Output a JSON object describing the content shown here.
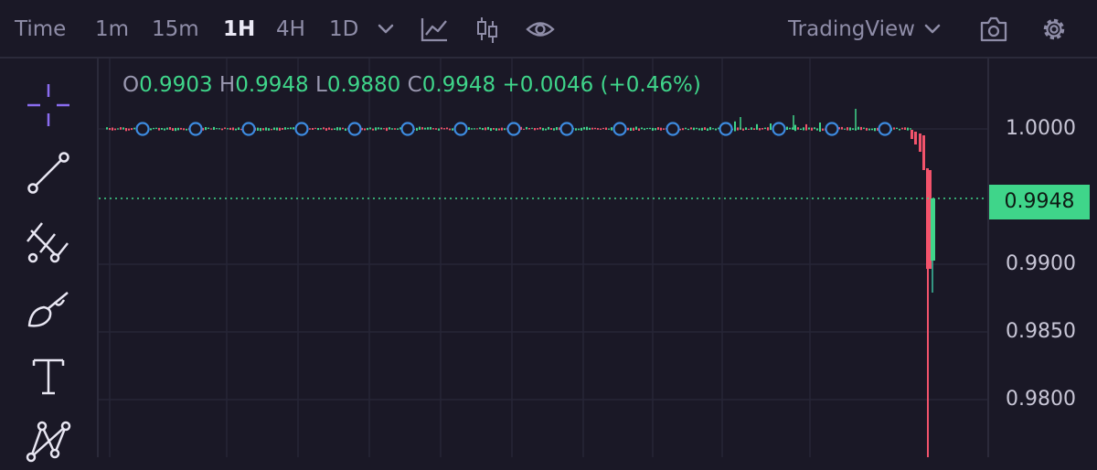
{
  "toolbar": {
    "time_label": "Time",
    "intervals": [
      "1m",
      "15m",
      "1H",
      "4H",
      "1D"
    ],
    "active_interval": "1H",
    "source_label": "TradingView"
  },
  "ohlc": {
    "open_key": "O",
    "open": "0.9903",
    "high_key": "H",
    "high": "0.9948",
    "low_key": "L",
    "low": "0.9880",
    "close_key": "C",
    "close": "0.9948",
    "change": "+0.0046",
    "change_pct": "(+0.46%)"
  },
  "axis": {
    "ticks": [
      "1.0000",
      "0.9900",
      "0.9850",
      "0.9800"
    ],
    "current_price": "0.9948"
  },
  "left_tools": [
    "crosshair-icon",
    "trend-line-icon",
    "fib-icon",
    "brush-icon",
    "text-icon",
    "pattern-icon"
  ],
  "colors": {
    "bg": "#1a1826",
    "up": "#3fd58a",
    "down": "#f2536b",
    "marker": "#3d8be0"
  }
}
